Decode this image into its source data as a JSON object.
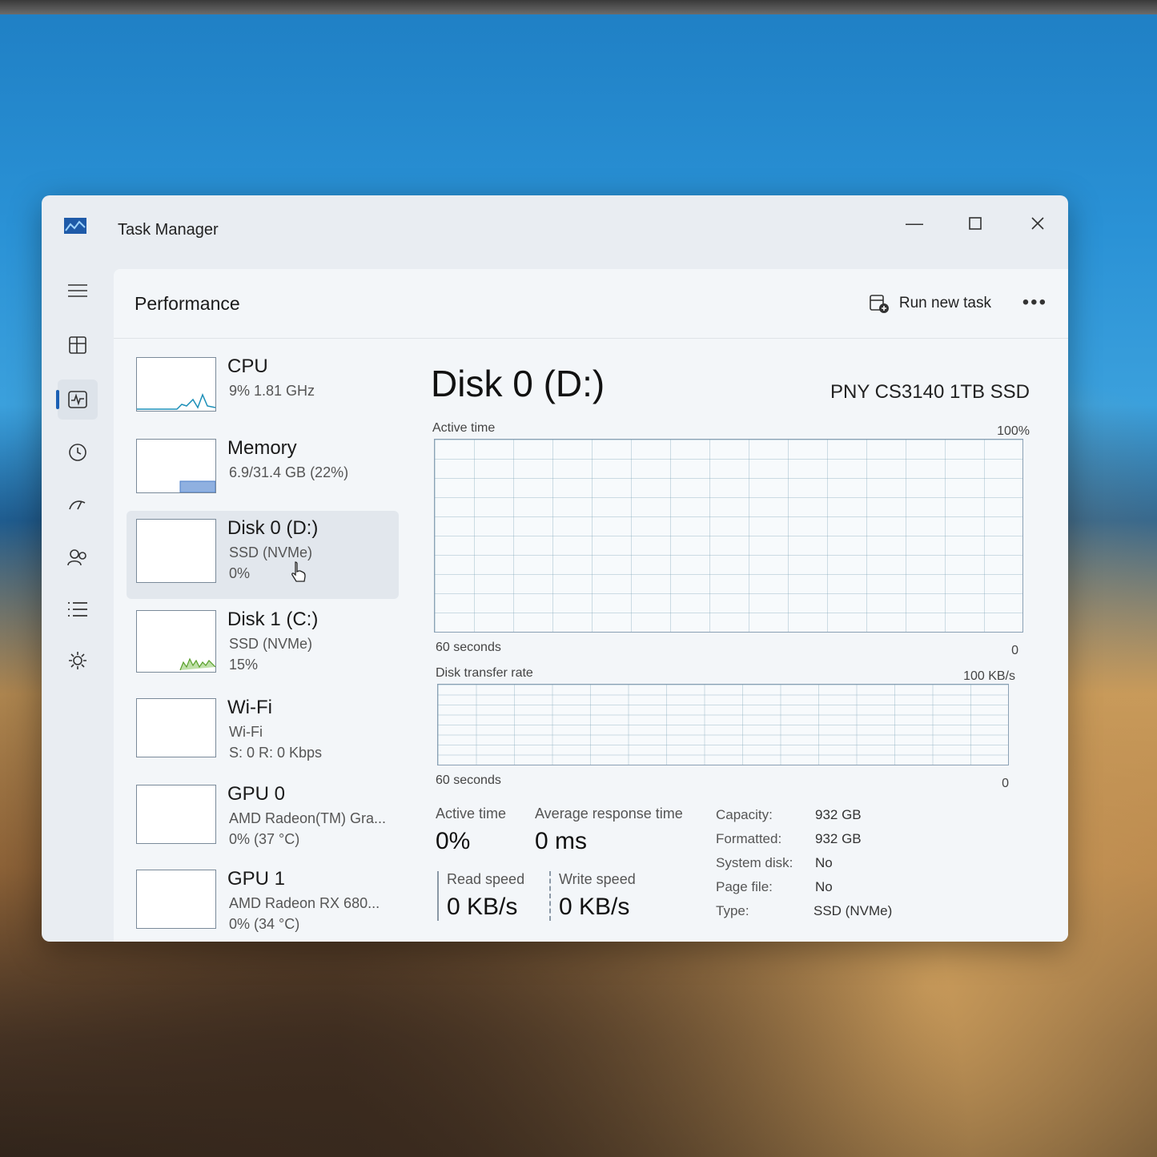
{
  "window": {
    "title": "Task Manager"
  },
  "header": {
    "title": "Performance",
    "run_new_task": "Run new task",
    "more": "•••"
  },
  "nav": {
    "items": [
      {
        "name": "hamburger-menu-icon"
      },
      {
        "name": "processes-icon"
      },
      {
        "name": "performance-icon"
      },
      {
        "name": "app-history-icon"
      },
      {
        "name": "startup-apps-icon"
      },
      {
        "name": "users-icon"
      },
      {
        "name": "details-icon"
      },
      {
        "name": "services-icon"
      }
    ],
    "settings": "settings-icon"
  },
  "devices": [
    {
      "title": "CPU",
      "line1": "9%  1.81 GHz",
      "line2": ""
    },
    {
      "title": "Memory",
      "line1": "6.9/31.4 GB (22%)",
      "line2": ""
    },
    {
      "title": "Disk 0 (D:)",
      "line1": "SSD (NVMe)",
      "line2": "0%"
    },
    {
      "title": "Disk 1 (C:)",
      "line1": "SSD (NVMe)",
      "line2": "15%"
    },
    {
      "title": "Wi-Fi",
      "line1": "Wi-Fi",
      "line2": "S: 0 R: 0 Kbps"
    },
    {
      "title": "GPU 0",
      "line1": "AMD Radeon(TM) Gra...",
      "line2": "0%  (37 °C)"
    },
    {
      "title": "GPU 1",
      "line1": "AMD Radeon RX 680...",
      "line2": "0%  (34 °C)"
    }
  ],
  "selected_device_index": 2,
  "detail": {
    "title": "Disk 0 (D:)",
    "model": "PNY CS3140 1TB SSD",
    "graph1": {
      "label": "Active time",
      "max": "100%",
      "time": "60 seconds",
      "min": "0"
    },
    "graph2": {
      "label": "Disk transfer rate",
      "max": "100 KB/s",
      "time": "60 seconds",
      "min": "0"
    },
    "stats": {
      "active_time_label": "Active time",
      "active_time_value": "0%",
      "avg_response_label": "Average response time",
      "avg_response_value": "0 ms",
      "read_speed_label": "Read speed",
      "read_speed_value": "0 KB/s",
      "write_speed_label": "Write speed",
      "write_speed_value": "0 KB/s"
    },
    "properties": [
      {
        "key": "Capacity:",
        "value": "932 GB"
      },
      {
        "key": "Formatted:",
        "value": "932 GB"
      },
      {
        "key": "System disk:",
        "value": "No"
      },
      {
        "key": "Page file:",
        "value": "No"
      },
      {
        "key": "Type:",
        "value": "SSD (NVMe)"
      }
    ]
  },
  "colors": {
    "accent": "#1a5fb4",
    "cpu_line": "#1b8fb8",
    "memory_fill": "#8fb0e0",
    "disk1_line": "#5aa02c"
  }
}
